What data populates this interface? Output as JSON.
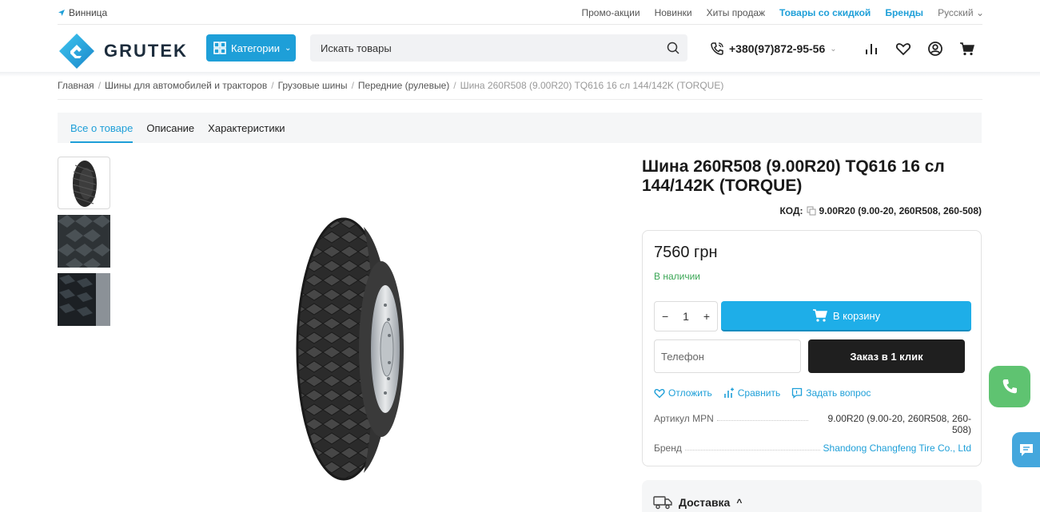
{
  "topbar": {
    "city": "Винница",
    "nav": [
      {
        "label": "Промо-акции",
        "accent": false
      },
      {
        "label": "Новинки",
        "accent": false
      },
      {
        "label": "Хиты продаж",
        "accent": false
      },
      {
        "label": "Товары со скидкой",
        "accent": true
      },
      {
        "label": "Бренды",
        "accent": true
      }
    ],
    "language": "Русский"
  },
  "header": {
    "logo_text": "GRUTEK",
    "categories_label": "Категории",
    "search_placeholder": "Искать товары",
    "phone": "+380(97)872-95-56"
  },
  "breadcrumb": [
    "Главная",
    "Шины для автомобилей и тракторов",
    "Грузовые шины",
    "Передние (рулевые)"
  ],
  "breadcrumb_current": "Шина 260R508 (9.00R20) TQ616 16 сл 144/142K (TORQUE)",
  "tabs": [
    {
      "label": "Все о товаре",
      "active": true
    },
    {
      "label": "Описание",
      "active": false
    },
    {
      "label": "Характеристики",
      "active": false
    }
  ],
  "product": {
    "title": "Шина 260R508 (9.00R20) TQ616 16 сл 144/142K (TORQUE)",
    "code_label": "КОД:",
    "code_value": "9.00R20 (9.00-20, 260R508, 260-508)",
    "price": "7560 грн",
    "availability": "В наличии",
    "quantity": "1",
    "add_to_cart": "В корзину",
    "phone_placeholder": "Телефон",
    "one_click": "Заказ в 1 клик",
    "actions": {
      "wishlist": "Отложить",
      "compare": "Сравнить",
      "ask": "Задать вопрос"
    },
    "specs": [
      {
        "key": "Артикул MPN",
        "value": "9.00R20 (9.00-20, 260R508, 260-508)"
      },
      {
        "key": "Бренд",
        "value": "Shandong Changfeng Tire Co., Ltd"
      }
    ],
    "delivery_label": "Доставка"
  },
  "colors": {
    "accent": "#1e9fd8",
    "cart_button": "#1eaee8",
    "in_stock": "#3aa655",
    "one_click": "#1f1f1f",
    "fab_phone": "#5fc371",
    "fab_chat": "#44a7dd"
  },
  "icons": {
    "city": "location-arrow-icon",
    "categories": "grid-icon",
    "search": "search-icon",
    "phone": "phone-icon",
    "compare": "bar-chart-icon",
    "wishlist": "heart-icon",
    "account": "user-icon",
    "cart": "cart-icon",
    "copy": "copy-icon",
    "delivery": "truck-icon",
    "chat": "chat-icon"
  }
}
